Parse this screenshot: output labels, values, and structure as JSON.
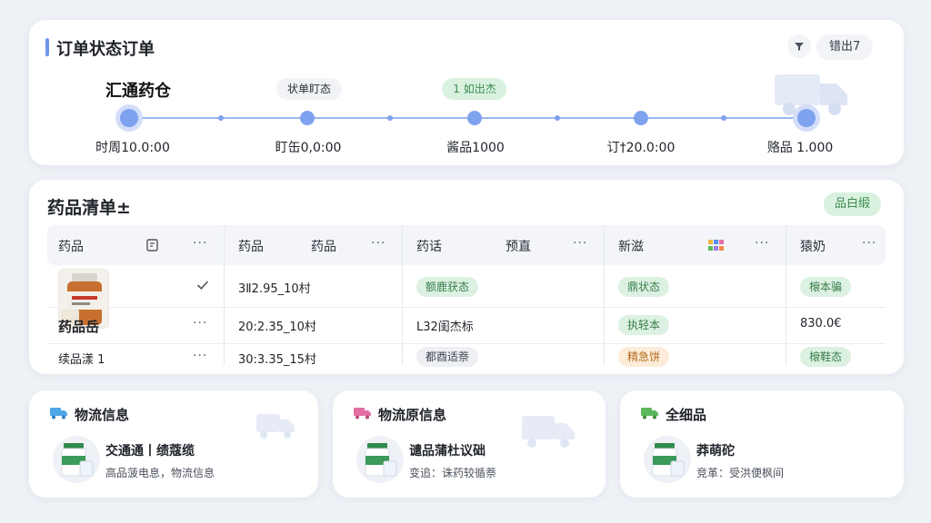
{
  "status_card": {
    "title": "订单状态订单",
    "export_label": "错出7",
    "warehouse": "汇通药仓",
    "step_pills": [
      "状单盯态",
      "1 如出杰"
    ],
    "step_times": [
      "时周10.0:00",
      "盯缶0,0:00",
      "酱品1000",
      "订†20.0:00",
      "赂品 1.000"
    ]
  },
  "list_card": {
    "title": "药品清单±",
    "tag": "品白缎",
    "headers": [
      "药品",
      "药品",
      "药品",
      "药话",
      "预直",
      "新滋",
      "猿奶"
    ],
    "rows": [
      {
        "spec": "3Ⅱ2.95_10村",
        "status": "额鹿获态",
        "badge": "鼎状态",
        "last": "榱本骗"
      },
      {
        "name": "药品岳",
        "spec": "20:2.35_10村",
        "batch": "L32闺杰标",
        "badge": "执轻本",
        "last": "830.0€"
      },
      {
        "name": "续品漾 1",
        "spec": "30:3.35_15村",
        "status": "都酉适萘",
        "badge": "精急饼",
        "last": "榱鞋态"
      }
    ]
  },
  "info_cards": [
    {
      "title": "物流信息",
      "name": "交通通丨绩蔻缆",
      "desc": "高品菠电息，物流信息",
      "icon": "truck-icon",
      "color": "#4fa7e8"
    },
    {
      "title": "物流原信息",
      "name": "谴品蒲杜议础",
      "desc": "变追：诛药较循萘",
      "icon": "truck-icon",
      "color": "#e46fa4"
    },
    {
      "title": "全细品",
      "name": "莽萌砣",
      "desc": "竞革：受洪便枫间",
      "icon": "truck-icon",
      "color": "#5cb85c"
    }
  ]
}
